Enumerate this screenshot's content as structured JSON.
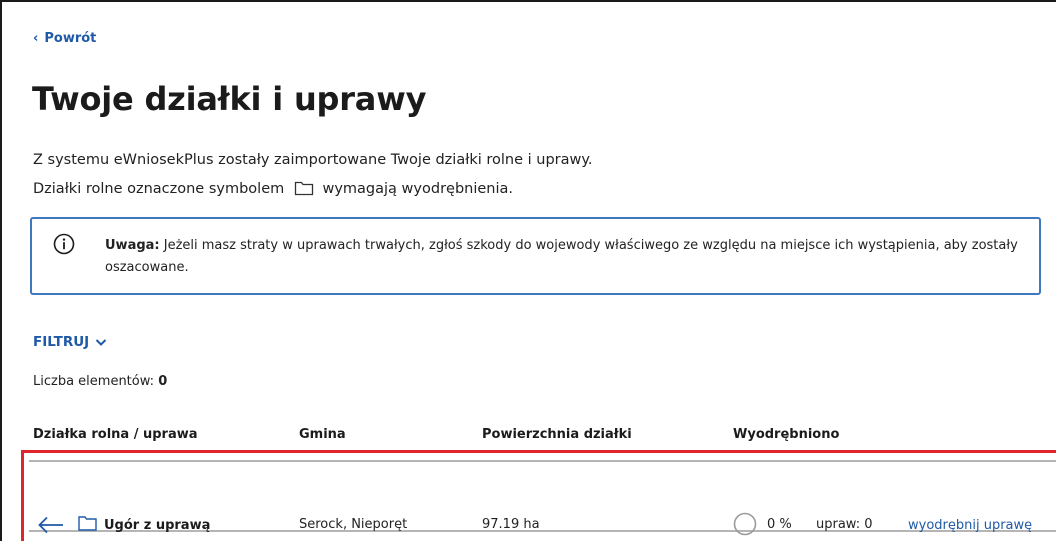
{
  "back_link": {
    "label": "Powrót"
  },
  "page": {
    "title": "Twoje działki i uprawy"
  },
  "intro": {
    "line1": "Z systemu eWniosekPlus zostały zaimportowane Twoje działki rolne i uprawy.",
    "line2_before": "Działki rolne oznaczone symbolem",
    "line2_after": "wymagają wyodrębnienia."
  },
  "notice": {
    "label": "Uwaga:",
    "text": " Jeżeli masz straty w uprawach trwałych, zgłoś szkody do wojewody właściwego ze względu na miejsce ich wystąpienia, aby zostały oszacowane."
  },
  "filter": {
    "label": "FILTRUJ"
  },
  "count": {
    "label": "Liczba elementów:",
    "value": "0"
  },
  "table": {
    "columns": [
      "Działka rolna / uprawa",
      "Gmina",
      "Powierzchnia działki",
      "Wyodrębniono"
    ],
    "rows": [
      {
        "name": "Ugór z uprawą",
        "gmina": "Serock, Nieporęt",
        "area": "97.19 ha",
        "percent": "0 %",
        "crops": "upraw: 0",
        "action": "wyodrębnij uprawę"
      }
    ]
  },
  "colors": {
    "link": "#1f5aa6",
    "notice_border": "#3f78bd",
    "highlight": "#e0242b"
  },
  "icons": [
    "chevron-left-icon",
    "folder-icon",
    "info-icon",
    "chevron-down-icon",
    "arrow-left-icon",
    "progress-circle-icon"
  ]
}
